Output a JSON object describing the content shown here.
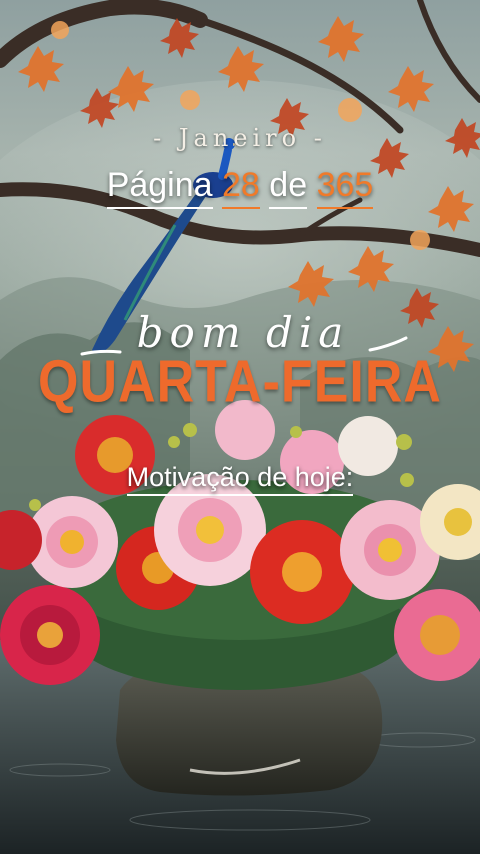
{
  "header": {
    "month_label": "- Janeiro -",
    "page_word": "Página",
    "page_number": "28",
    "of_word": "de",
    "total_pages": "365"
  },
  "greeting": {
    "script_text": "bom dia",
    "weekday": "QUARTA-FEIRA"
  },
  "motivation": {
    "label": "Motivação de hoje:"
  },
  "colors": {
    "accent_orange": "#ee6a2c",
    "text_white": "#ffffff"
  }
}
